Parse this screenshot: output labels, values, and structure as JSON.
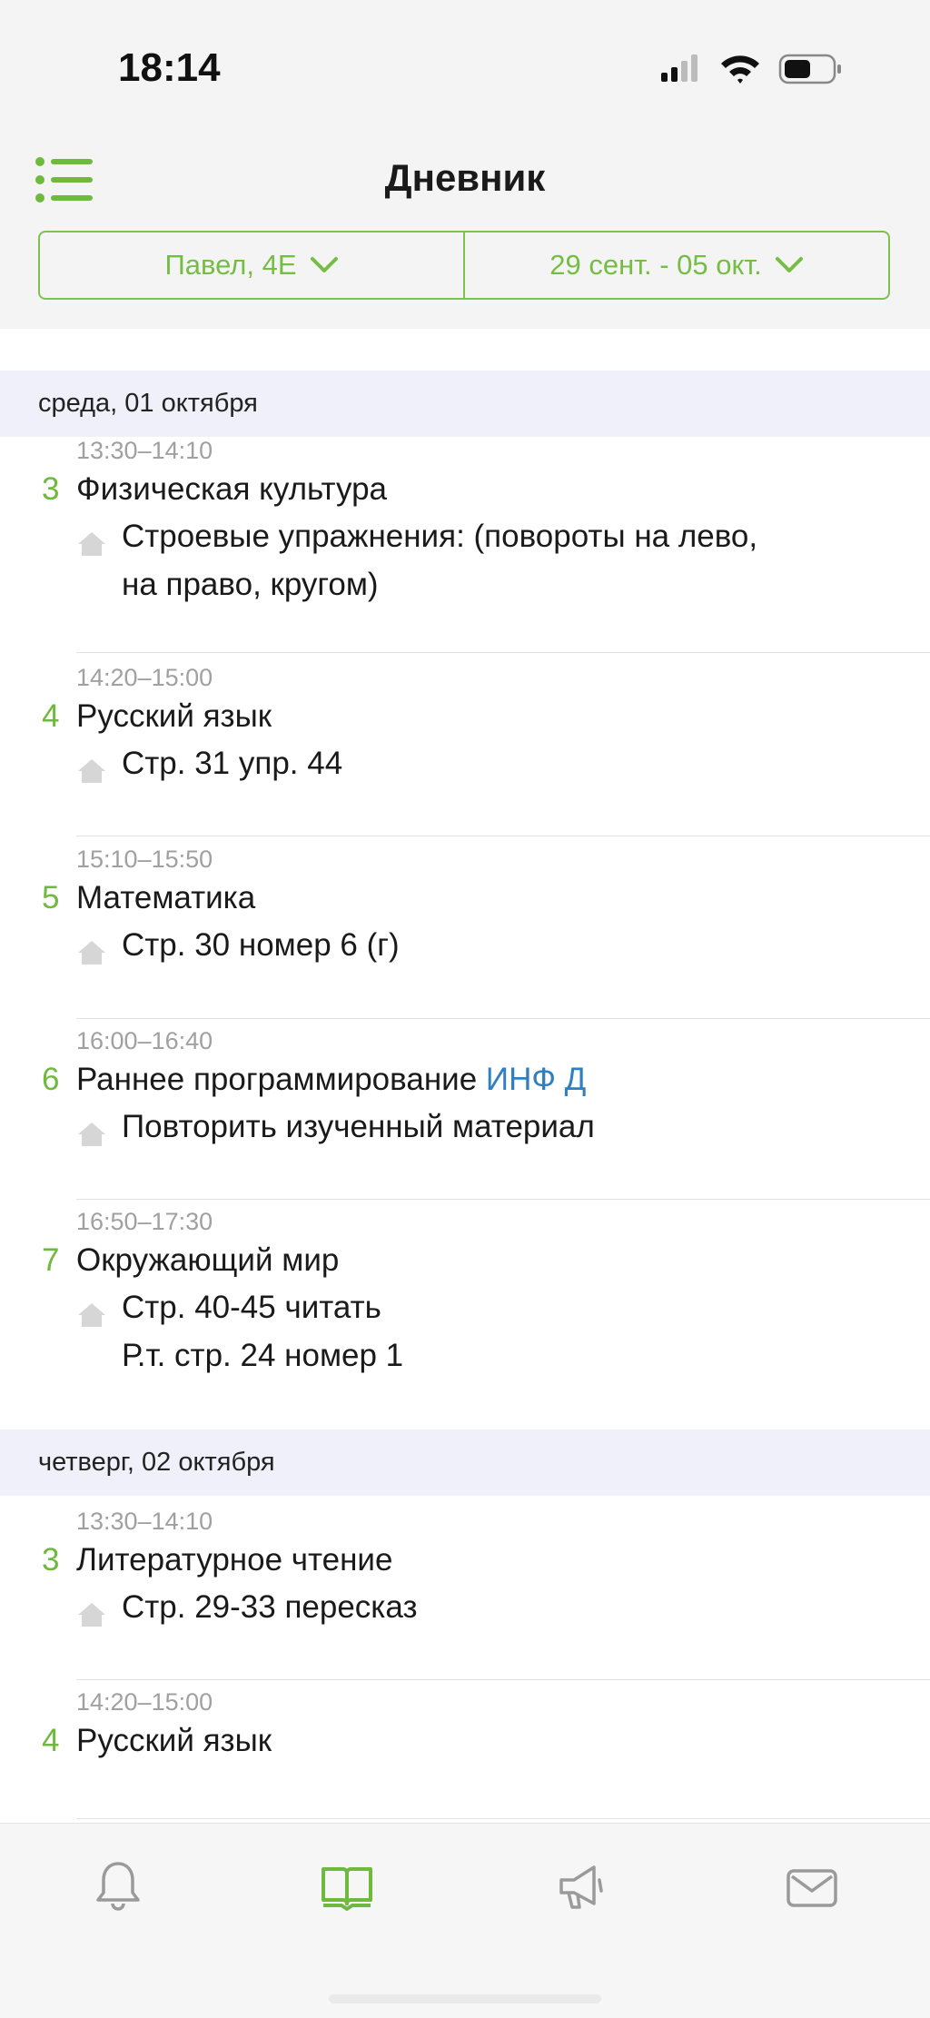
{
  "status_bar": {
    "time": "18:14"
  },
  "nav": {
    "title": "Дневник"
  },
  "selector": {
    "student": "Павел, 4Е",
    "week": "29 сент. - 05 окт."
  },
  "days": [
    {
      "header": "среда, 01 октября",
      "lessons": [
        {
          "num": "3",
          "time": "13:30–14:10",
          "subject": "Физическая культура",
          "teacher": "",
          "homework": "Строевые упражнения: (повороты на лево,\nна право, кругом)"
        },
        {
          "num": "4",
          "time": "14:20–15:00",
          "subject": "Русский язык",
          "teacher": "",
          "homework": "Стр. 31 упр. 44"
        },
        {
          "num": "5",
          "time": "15:10–15:50",
          "subject": "Математика",
          "teacher": "",
          "homework": "Стр. 30 номер 6 (г)"
        },
        {
          "num": "6",
          "time": "16:00–16:40",
          "subject": "Раннее программирование",
          "teacher": "ИНФ Д",
          "homework": "Повторить изученный материал"
        },
        {
          "num": "7",
          "time": "16:50–17:30",
          "subject": "Окружающий мир",
          "teacher": "",
          "homework": "Стр. 40-45 читать\nР.т. стр. 24 номер 1"
        }
      ]
    },
    {
      "header": "четверг, 02 октября",
      "lessons": [
        {
          "num": "3",
          "time": "13:30–14:10",
          "subject": "Литературное чтение",
          "teacher": "",
          "homework": "Стр. 29-33 пересказ"
        },
        {
          "num": "4",
          "time": "14:20–15:00",
          "subject": "Русский язык",
          "teacher": "",
          "homework": ""
        }
      ]
    }
  ],
  "tab_bar": {
    "tabs": [
      {
        "icon": "bell-icon"
      },
      {
        "icon": "book-icon",
        "active": true
      },
      {
        "icon": "megaphone-icon"
      },
      {
        "icon": "mail-icon"
      }
    ]
  },
  "colors": {
    "accent": "#76bd45",
    "link": "#2f7fc1",
    "day_header_bg": "#f0f0fa"
  }
}
